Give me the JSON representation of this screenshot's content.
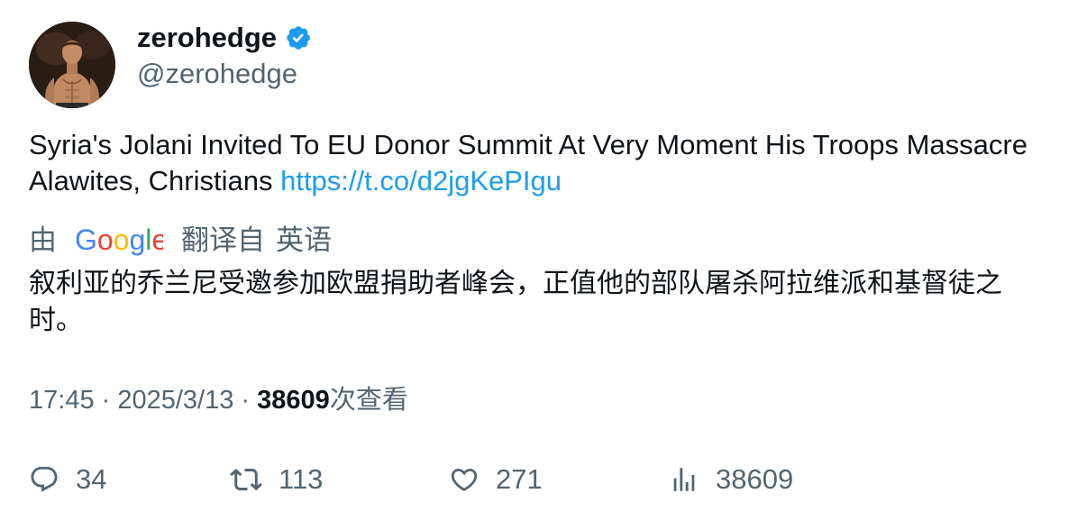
{
  "author": {
    "display_name": "zerohedge",
    "handle": "@zerohedge",
    "verified": true,
    "verified_color": "#1d9bf0"
  },
  "tweet": {
    "text": "Syria's Jolani Invited To EU Donor Summit At Very Moment His Troops Massacre Alawites, Christians ",
    "link": "https://t.co/d2jgKePIgu",
    "link_color": "#1d9bf0"
  },
  "translation": {
    "by_label": "由",
    "provider": "Google",
    "from_label": "翻译自",
    "language": "英语",
    "text": "叙利亚的乔兰尼受邀参加欧盟捐助者峰会，正值他的部队屠杀阿拉维派和基督徒之时。"
  },
  "meta": {
    "time": "17:45",
    "separator": " · ",
    "date": "2025/3/13",
    "views_count": "38609",
    "views_label": "次查看"
  },
  "actions": {
    "reply_count": "34",
    "retweet_count": "113",
    "like_count": "271",
    "views_count": "38609"
  },
  "icons": {
    "avatar": "profile-photo",
    "verified": "verified-badge-icon",
    "reply": "comment-bubble-icon",
    "retweet": "retweet-icon",
    "like": "heart-icon",
    "views": "bar-chart-icon"
  },
  "colors": {
    "text_primary": "#0f1419",
    "text_secondary": "#536471",
    "accent": "#1d9bf0"
  }
}
